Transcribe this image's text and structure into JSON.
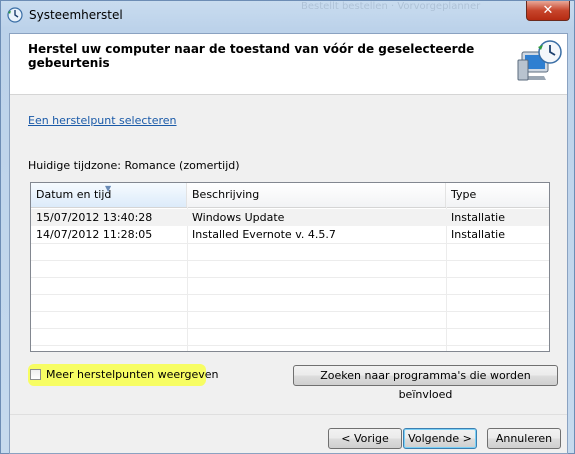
{
  "window": {
    "title": "Systeemherstel",
    "close_label": "✕",
    "background_ghost_text": "Bestellt bestellen     ·  Vorvorgeplanner"
  },
  "header": {
    "heading": "Herstel uw computer naar de toestand van vóór de geselecteerde gebeurtenis"
  },
  "link": {
    "label": "Een herstelpunt selecteren"
  },
  "timezone": {
    "label": "Huidige tijdzone: Romance (zomertijd)"
  },
  "table": {
    "columns": [
      "Datum en tijd",
      "Beschrijving",
      "Type"
    ],
    "rows": [
      {
        "date": "15/07/2012 13:40:28",
        "description": "Windows Update",
        "type": "Installatie"
      },
      {
        "date": "14/07/2012 11:28:05",
        "description": "Installed Evernote v. 4.5.7",
        "type": "Installatie"
      }
    ]
  },
  "checkbox": {
    "label": "Meer herstelpunten weergeven",
    "checked": false,
    "highlight_color": "#f8ff4a"
  },
  "buttons": {
    "search": "Zoeken naar programma's die worden beïnvloed",
    "prev": "< Vorige",
    "next": "Volgende >",
    "cancel": "Annuleren"
  },
  "icons": {
    "app": "system-restore-icon",
    "header": "computer-restore-clock-icon"
  }
}
